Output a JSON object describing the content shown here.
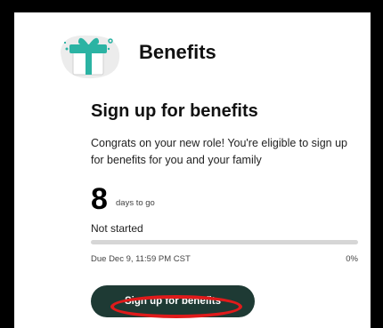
{
  "header": {
    "title": "Benefits",
    "icon": "gift-icon"
  },
  "task": {
    "heading": "Sign up for benefits",
    "description": "Congrats on your new role! You're eligible to sign up for benefits for you and your family",
    "days_remaining": "8",
    "days_label": "days to go",
    "status": "Not started",
    "progress": 0,
    "due": "Due Dec 9, 11:59 PM CST",
    "percent_label": "0%"
  },
  "cta": {
    "label": "Sign up for benefits"
  },
  "colors": {
    "accent": "#1e3a34",
    "icon_teal": "#2bb3a3",
    "highlight": "#e01b1b"
  }
}
